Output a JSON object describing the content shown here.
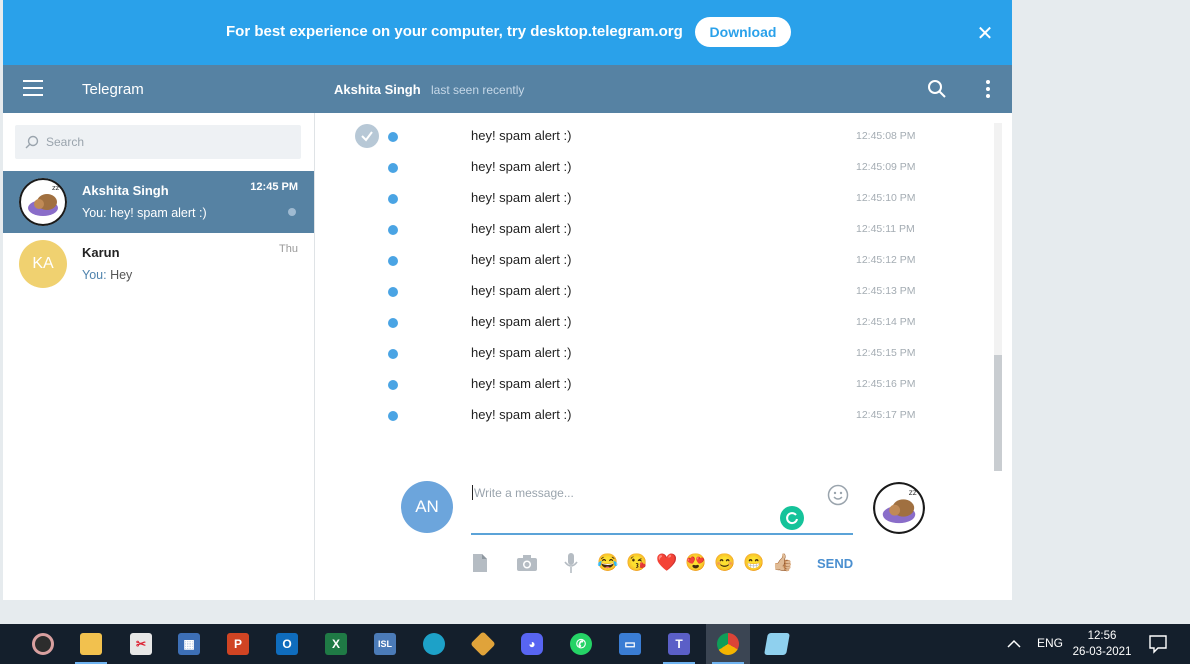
{
  "banner": {
    "text": "For best experience on your computer, try desktop.telegram.org",
    "button_label": "Download",
    "close_icon": "close-icon"
  },
  "header": {
    "app_title": "Telegram",
    "peer_name": "Akshita Singh",
    "peer_status": "last seen recently"
  },
  "search": {
    "placeholder": "Search"
  },
  "dialogs": [
    {
      "name": "Akshita Singh",
      "time": "12:45 PM",
      "you": "You:",
      "message": "hey! spam alert :)",
      "active": true
    },
    {
      "name": "Karun",
      "initials": "KA",
      "time": "Thu",
      "you": "You:",
      "message": "Hey",
      "active": false
    }
  ],
  "messages": [
    {
      "text": "hey! spam alert :)",
      "time": "12:45:08 PM"
    },
    {
      "text": "hey! spam alert :)",
      "time": "12:45:09 PM"
    },
    {
      "text": "hey! spam alert :)",
      "time": "12:45:10 PM"
    },
    {
      "text": "hey! spam alert :)",
      "time": "12:45:11 PM"
    },
    {
      "text": "hey! spam alert :)",
      "time": "12:45:12 PM"
    },
    {
      "text": "hey! spam alert :)",
      "time": "12:45:13 PM"
    },
    {
      "text": "hey! spam alert :)",
      "time": "12:45:14 PM"
    },
    {
      "text": "hey! spam alert :)",
      "time": "12:45:15 PM"
    },
    {
      "text": "hey! spam alert :)",
      "time": "12:45:16 PM"
    },
    {
      "text": "hey! spam alert :)",
      "time": "12:45:17 PM"
    }
  ],
  "composer": {
    "my_initials": "AN",
    "placeholder": "Write a message...",
    "send_label": "SEND",
    "emoji_row": [
      "😂",
      "😘",
      "❤️",
      "😍",
      "😊",
      "😁",
      "👍🏼"
    ]
  },
  "taskbar": {
    "language": "ENG",
    "time": "12:56",
    "date": "26-03-2021"
  },
  "colors": {
    "banner": "#2aa1ea",
    "header": "#5682a3",
    "accent": "#4aa4e4",
    "taskbar": "#141f2c"
  }
}
